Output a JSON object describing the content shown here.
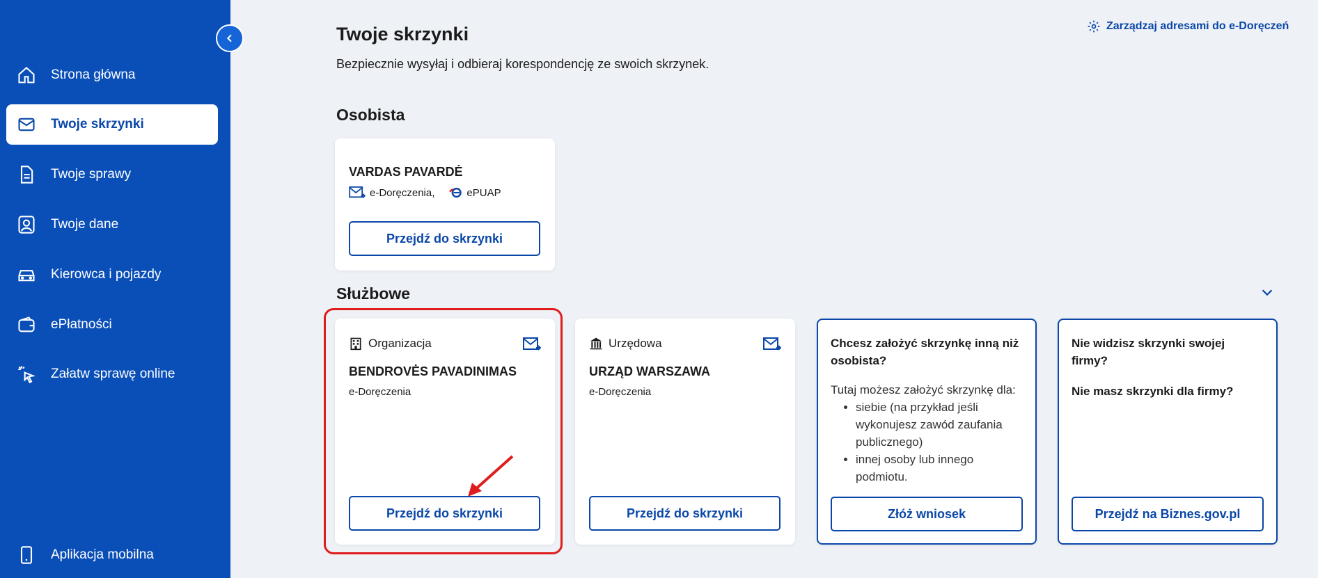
{
  "sidebar": {
    "items": [
      {
        "label": "Strona główna"
      },
      {
        "label": "Twoje skrzynki"
      },
      {
        "label": "Twoje sprawy"
      },
      {
        "label": "Twoje dane"
      },
      {
        "label": "Kierowca i pojazdy"
      },
      {
        "label": "ePłatności"
      },
      {
        "label": "Załatw sprawę online"
      }
    ],
    "bottom_item": {
      "label": "Aplikacja mobilna"
    }
  },
  "header": {
    "title": "Twoje skrzynki",
    "description": "Bezpiecznie wysyłaj i odbieraj korespondencję ze swoich skrzynek.",
    "manage_link": "Zarządzaj adresami do e-Doręczeń"
  },
  "personal": {
    "section_title": "Osobista",
    "card": {
      "name": "VARDAS PAVARDĖ",
      "service1": "e-Doręczenia,",
      "service2": "ePUAP",
      "button": "Przejdź do skrzynki"
    }
  },
  "business": {
    "section_title": "Służbowe",
    "cards": [
      {
        "type": "Organizacja",
        "name": "BENDROVĖS PAVADINIMAS",
        "service": "e-Doręczenia",
        "button": "Przejdź do skrzynki"
      },
      {
        "type": "Urzędowa",
        "name": "URZĄD WARSZAWA",
        "service": "e-Doręczenia",
        "button": "Przejdź do skrzynki"
      }
    ],
    "info_create": {
      "title": "Chcesz założyć skrzynkę inną niż osobista?",
      "intro": "Tutaj możesz założyć skrzynkę dla:",
      "items": [
        "siebie (na przykład jeśli wykonujesz zawód zaufania publicznego)",
        "innej osoby lub innego podmiotu."
      ],
      "button": "Złóż wniosek"
    },
    "info_firm": {
      "title1": "Nie widzisz skrzynki swojej firmy?",
      "title2": "Nie masz skrzynki dla firmy?",
      "button": "Przejdź na Biznes.gov.pl"
    }
  },
  "colors": {
    "sidebar_bg": "#0a4fb8",
    "accent": "#0a47a8",
    "highlight": "#e01c1c"
  }
}
